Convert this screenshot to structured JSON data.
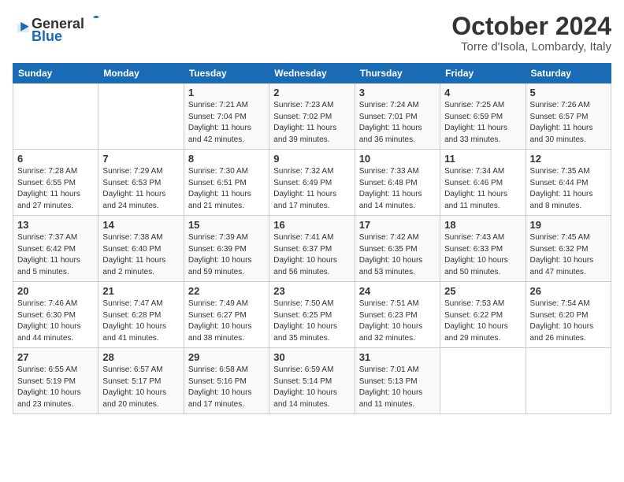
{
  "logo": {
    "general": "General",
    "blue": "Blue"
  },
  "header": {
    "month": "October 2024",
    "location": "Torre d'Isola, Lombardy, Italy"
  },
  "weekdays": [
    "Sunday",
    "Monday",
    "Tuesday",
    "Wednesday",
    "Thursday",
    "Friday",
    "Saturday"
  ],
  "weeks": [
    [
      {
        "day": "",
        "info": ""
      },
      {
        "day": "",
        "info": ""
      },
      {
        "day": "1",
        "info": "Sunrise: 7:21 AM\nSunset: 7:04 PM\nDaylight: 11 hours and 42 minutes."
      },
      {
        "day": "2",
        "info": "Sunrise: 7:23 AM\nSunset: 7:02 PM\nDaylight: 11 hours and 39 minutes."
      },
      {
        "day": "3",
        "info": "Sunrise: 7:24 AM\nSunset: 7:01 PM\nDaylight: 11 hours and 36 minutes."
      },
      {
        "day": "4",
        "info": "Sunrise: 7:25 AM\nSunset: 6:59 PM\nDaylight: 11 hours and 33 minutes."
      },
      {
        "day": "5",
        "info": "Sunrise: 7:26 AM\nSunset: 6:57 PM\nDaylight: 11 hours and 30 minutes."
      }
    ],
    [
      {
        "day": "6",
        "info": "Sunrise: 7:28 AM\nSunset: 6:55 PM\nDaylight: 11 hours and 27 minutes."
      },
      {
        "day": "7",
        "info": "Sunrise: 7:29 AM\nSunset: 6:53 PM\nDaylight: 11 hours and 24 minutes."
      },
      {
        "day": "8",
        "info": "Sunrise: 7:30 AM\nSunset: 6:51 PM\nDaylight: 11 hours and 21 minutes."
      },
      {
        "day": "9",
        "info": "Sunrise: 7:32 AM\nSunset: 6:49 PM\nDaylight: 11 hours and 17 minutes."
      },
      {
        "day": "10",
        "info": "Sunrise: 7:33 AM\nSunset: 6:48 PM\nDaylight: 11 hours and 14 minutes."
      },
      {
        "day": "11",
        "info": "Sunrise: 7:34 AM\nSunset: 6:46 PM\nDaylight: 11 hours and 11 minutes."
      },
      {
        "day": "12",
        "info": "Sunrise: 7:35 AM\nSunset: 6:44 PM\nDaylight: 11 hours and 8 minutes."
      }
    ],
    [
      {
        "day": "13",
        "info": "Sunrise: 7:37 AM\nSunset: 6:42 PM\nDaylight: 11 hours and 5 minutes."
      },
      {
        "day": "14",
        "info": "Sunrise: 7:38 AM\nSunset: 6:40 PM\nDaylight: 11 hours and 2 minutes."
      },
      {
        "day": "15",
        "info": "Sunrise: 7:39 AM\nSunset: 6:39 PM\nDaylight: 10 hours and 59 minutes."
      },
      {
        "day": "16",
        "info": "Sunrise: 7:41 AM\nSunset: 6:37 PM\nDaylight: 10 hours and 56 minutes."
      },
      {
        "day": "17",
        "info": "Sunrise: 7:42 AM\nSunset: 6:35 PM\nDaylight: 10 hours and 53 minutes."
      },
      {
        "day": "18",
        "info": "Sunrise: 7:43 AM\nSunset: 6:33 PM\nDaylight: 10 hours and 50 minutes."
      },
      {
        "day": "19",
        "info": "Sunrise: 7:45 AM\nSunset: 6:32 PM\nDaylight: 10 hours and 47 minutes."
      }
    ],
    [
      {
        "day": "20",
        "info": "Sunrise: 7:46 AM\nSunset: 6:30 PM\nDaylight: 10 hours and 44 minutes."
      },
      {
        "day": "21",
        "info": "Sunrise: 7:47 AM\nSunset: 6:28 PM\nDaylight: 10 hours and 41 minutes."
      },
      {
        "day": "22",
        "info": "Sunrise: 7:49 AM\nSunset: 6:27 PM\nDaylight: 10 hours and 38 minutes."
      },
      {
        "day": "23",
        "info": "Sunrise: 7:50 AM\nSunset: 6:25 PM\nDaylight: 10 hours and 35 minutes."
      },
      {
        "day": "24",
        "info": "Sunrise: 7:51 AM\nSunset: 6:23 PM\nDaylight: 10 hours and 32 minutes."
      },
      {
        "day": "25",
        "info": "Sunrise: 7:53 AM\nSunset: 6:22 PM\nDaylight: 10 hours and 29 minutes."
      },
      {
        "day": "26",
        "info": "Sunrise: 7:54 AM\nSunset: 6:20 PM\nDaylight: 10 hours and 26 minutes."
      }
    ],
    [
      {
        "day": "27",
        "info": "Sunrise: 6:55 AM\nSunset: 5:19 PM\nDaylight: 10 hours and 23 minutes."
      },
      {
        "day": "28",
        "info": "Sunrise: 6:57 AM\nSunset: 5:17 PM\nDaylight: 10 hours and 20 minutes."
      },
      {
        "day": "29",
        "info": "Sunrise: 6:58 AM\nSunset: 5:16 PM\nDaylight: 10 hours and 17 minutes."
      },
      {
        "day": "30",
        "info": "Sunrise: 6:59 AM\nSunset: 5:14 PM\nDaylight: 10 hours and 14 minutes."
      },
      {
        "day": "31",
        "info": "Sunrise: 7:01 AM\nSunset: 5:13 PM\nDaylight: 10 hours and 11 minutes."
      },
      {
        "day": "",
        "info": ""
      },
      {
        "day": "",
        "info": ""
      }
    ]
  ]
}
